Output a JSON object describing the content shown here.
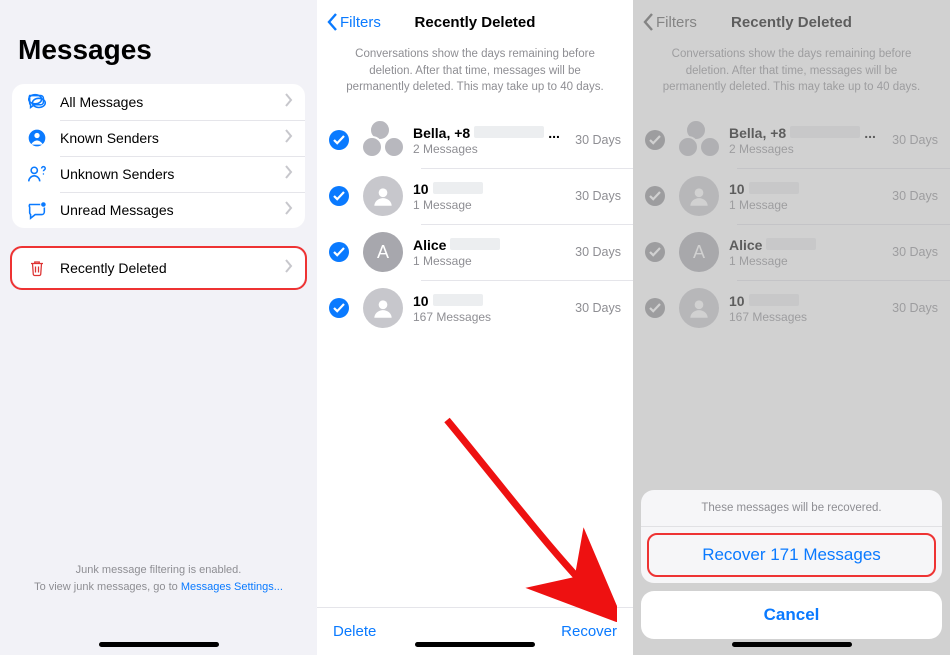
{
  "pane1": {
    "title": "Messages",
    "filters": [
      {
        "label": "All Messages",
        "icon": "chat-bubbles-icon",
        "color": "#0a7aff"
      },
      {
        "label": "Known Senders",
        "icon": "person-circle-icon",
        "color": "#0a7aff"
      },
      {
        "label": "Unknown Senders",
        "icon": "person-question-icon",
        "color": "#0a7aff"
      },
      {
        "label": "Unread Messages",
        "icon": "chat-dot-icon",
        "color": "#0a7aff"
      }
    ],
    "recently_deleted": {
      "label": "Recently Deleted",
      "icon": "trash-icon"
    },
    "footnote_line1": "Junk message filtering is enabled.",
    "footnote_line2_prefix": "To view junk messages, go to ",
    "footnote_link": "Messages Settings..."
  },
  "pane2": {
    "back_label": "Filters",
    "title": "Recently Deleted",
    "info": "Conversations show the days remaining before deletion. After that time, messages will be permanently deleted. This may take up to 40 days.",
    "conversations": [
      {
        "name": "Bella, +8",
        "sub": "2 Messages",
        "days": "30 Days",
        "avatar": "group",
        "dots": true
      },
      {
        "name": "10",
        "sub": "1 Message",
        "days": "30 Days",
        "avatar": "person"
      },
      {
        "name": "Alice",
        "sub": "1 Message",
        "days": "30 Days",
        "avatar": "letter",
        "letter": "A"
      },
      {
        "name": "10",
        "sub": "167 Messages",
        "days": "30 Days",
        "avatar": "person"
      }
    ],
    "delete_label": "Delete",
    "recover_label": "Recover"
  },
  "pane3": {
    "back_label": "Filters",
    "title": "Recently Deleted",
    "sheet_title": "These messages will be recovered.",
    "recover_btn": "Recover 171 Messages",
    "cancel_btn": "Cancel"
  }
}
